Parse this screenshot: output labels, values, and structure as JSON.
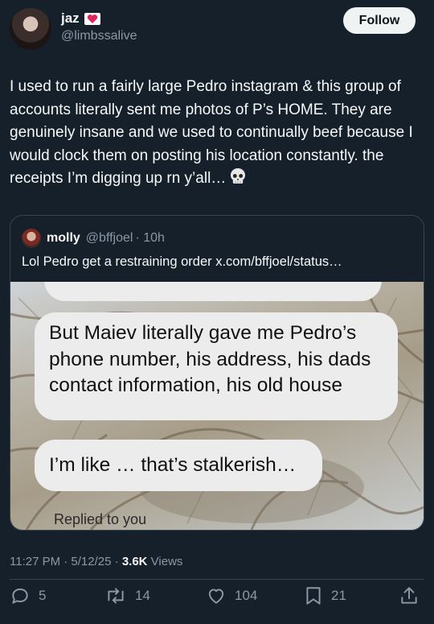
{
  "author": {
    "name": "jaz",
    "handle": "@limbssalive",
    "badge_icon": "heart-letter-icon"
  },
  "follow_button": {
    "label": "Follow"
  },
  "tweet": {
    "text": "I used to run a fairly large Pedro instagram & this group of accounts literally sent me photos of P’s HOME. They are genuinely insane and we used to continually beef because I would clock them on posting his location constantly. the receipts I’m digging up rn y’all…",
    "emoji_icon": "skull-icon"
  },
  "quote": {
    "name": "molly",
    "handle": "@bffjoel",
    "time": "· 10h",
    "text": "Lol Pedro get a restraining order x.com/bffjoel/status…",
    "image": {
      "bubble_1": "But Maiev literally gave me Pedro’s phone number, his address, his dads contact information, his old house",
      "bubble_2": "I’m like … that’s stalkerish…",
      "replied": "Replied to you"
    }
  },
  "meta": {
    "time_date": "11:27 PM · 5/12/25 · ",
    "views_count": "3.6K",
    "views_label": " Views"
  },
  "actions": {
    "replies": "5",
    "reposts": "14",
    "likes": "104",
    "bookmarks": "21"
  },
  "colors": {
    "background": "#15202b",
    "text": "#f7f9f9",
    "secondary": "#8b98a5",
    "border": "#38444d"
  }
}
